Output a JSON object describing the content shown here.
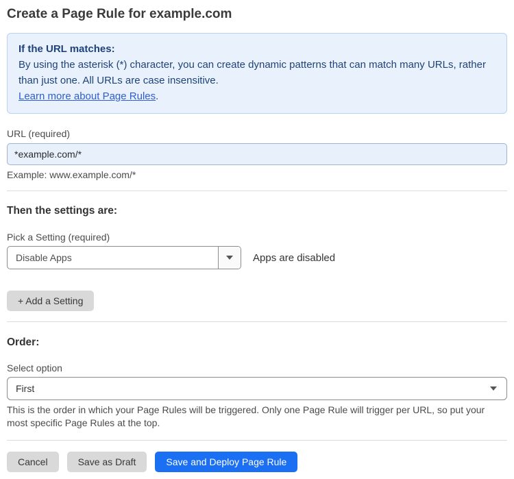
{
  "page": {
    "title": "Create a Page Rule for example.com"
  },
  "info_box": {
    "heading": "If the URL matches:",
    "body": "By using the asterisk (*) character, you can create dynamic patterns that can match many URLs, rather than just one. All URLs are case insensitive.",
    "link_label": "Learn more about Page Rules",
    "link_suffix": "."
  },
  "url_field": {
    "label": "URL (required)",
    "value": "*example.com/*",
    "hint": "Example: www.example.com/*"
  },
  "settings_section": {
    "heading": "Then the settings are:",
    "picker_label": "Pick a Setting (required)",
    "selected_setting": "Disable Apps",
    "status_text": "Apps are disabled",
    "add_setting_label": "+ Add a Setting"
  },
  "order_section": {
    "heading": "Order:",
    "select_label": "Select option",
    "selected_option": "First",
    "description": "This is the order in which your Page Rules will be triggered. Only one Page Rule will trigger per URL, so put your most specific Page Rules at the top."
  },
  "footer": {
    "cancel_label": "Cancel",
    "save_draft_label": "Save as Draft",
    "save_deploy_label": "Save and Deploy Page Rule"
  },
  "colors": {
    "primary_blue": "#1a6ff2",
    "info_background": "#e9f2fc",
    "info_border": "#b6d2f0",
    "info_text": "#1e4278",
    "link_blue": "#2e5cd4",
    "input_background": "#e8f0fb",
    "button_gray": "#d9d9d9"
  },
  "icons": {
    "dropdown_arrow": "chevron-down"
  }
}
